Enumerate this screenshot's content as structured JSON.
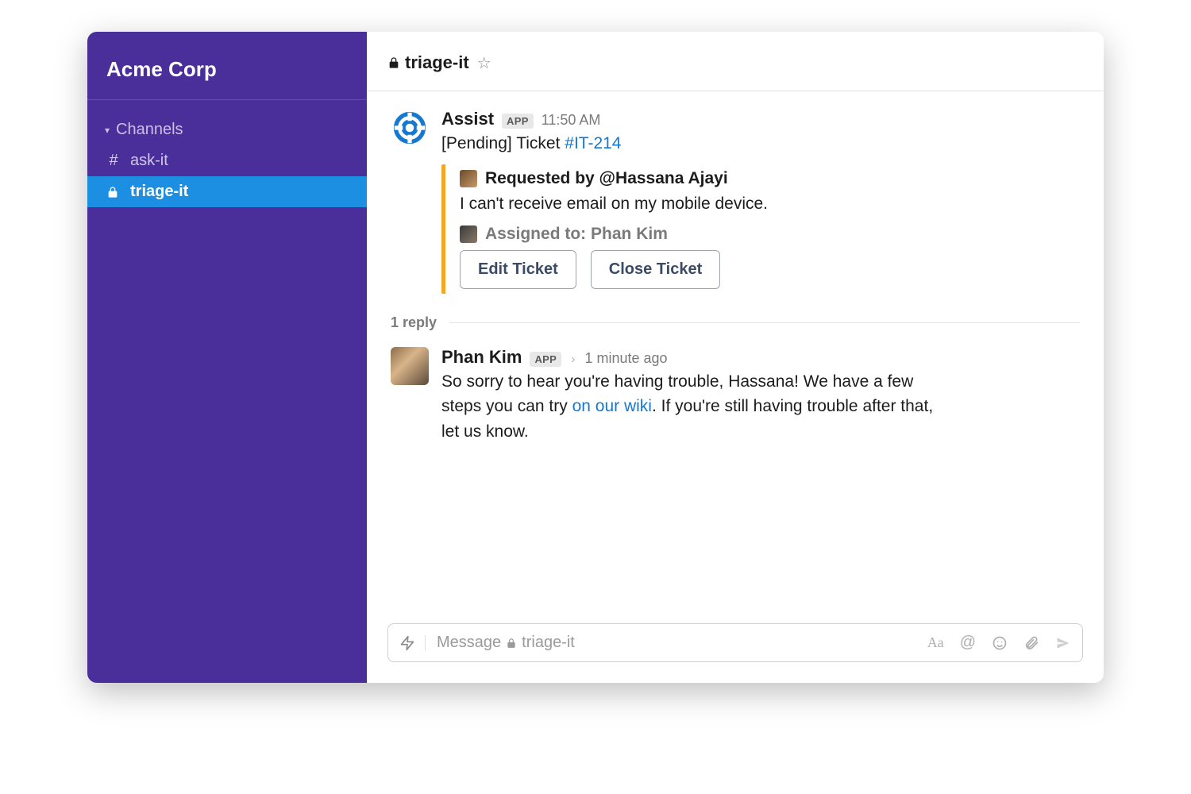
{
  "workspace": {
    "name": "Acme Corp"
  },
  "sidebar": {
    "section_label": "Channels",
    "channels": [
      {
        "prefix": "#",
        "name": "ask-it",
        "active": false,
        "private": false
      },
      {
        "prefix": "lock",
        "name": "triage-it",
        "active": true,
        "private": true
      }
    ]
  },
  "header": {
    "private": true,
    "channel_name": "triage-it"
  },
  "messages": {
    "assist": {
      "author": "Assist",
      "badge": "APP",
      "time": "11:50 AM",
      "status_prefix": "[Pending] Ticket ",
      "ticket_id": "#IT-214",
      "attachment": {
        "requested_label": "Requested by ",
        "requested_user": "@Hassana Ajayi",
        "description": "I can't receive email on my mobile device.",
        "assigned_label": "Assigned to: ",
        "assigned_user": "Phan Kim",
        "buttons": {
          "edit": "Edit Ticket",
          "close": "Close Ticket"
        }
      }
    },
    "thread": {
      "count_label": "1 reply"
    },
    "reply": {
      "author": "Phan Kim",
      "badge": "APP",
      "time_prefix": "> ",
      "time": "1 minute ago",
      "body_before": "So sorry to hear you're having trouble, Hassana! We have a few steps you can try ",
      "link_text": "on our wiki",
      "body_after": ". If you're still having trouble after that, let us know."
    }
  },
  "composer": {
    "placeholder_prefix": "Message ",
    "placeholder_channel": "triage-it",
    "icons": {
      "aa": "Aa",
      "mention": "@"
    }
  }
}
